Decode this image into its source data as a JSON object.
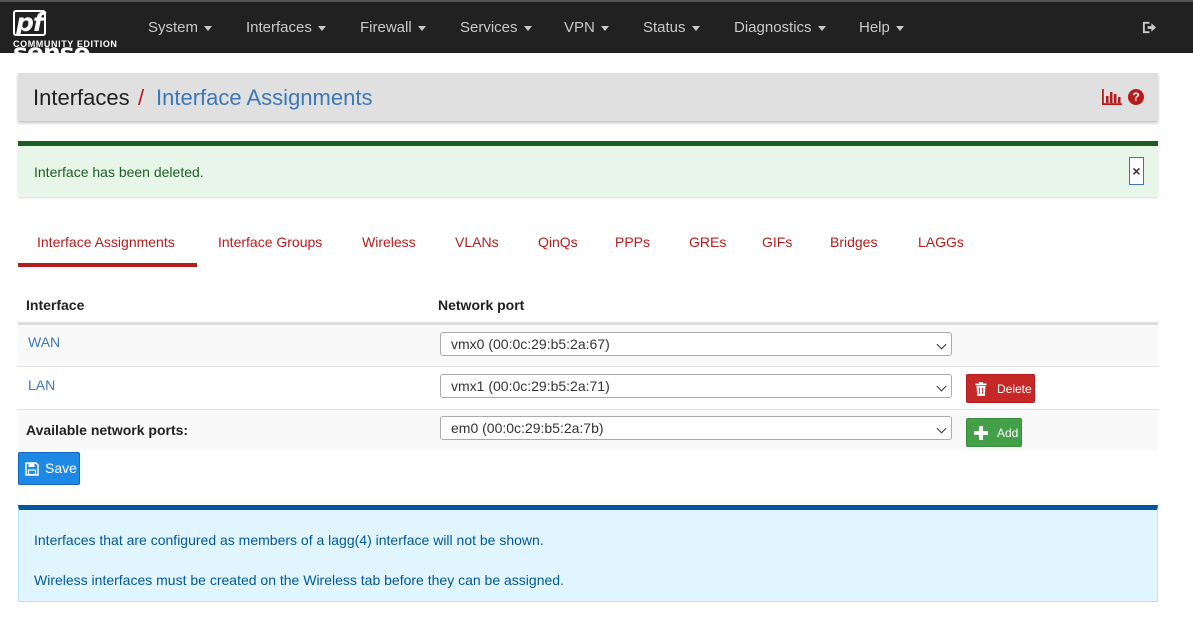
{
  "navbar": {
    "brand": "sense",
    "brand_prefix": "pf",
    "edition": "COMMUNITY EDITION",
    "items": [
      {
        "label": "System"
      },
      {
        "label": "Interfaces"
      },
      {
        "label": "Firewall"
      },
      {
        "label": "Services"
      },
      {
        "label": "VPN"
      },
      {
        "label": "Status"
      },
      {
        "label": "Diagnostics"
      },
      {
        "label": "Help"
      }
    ]
  },
  "breadcrumb": {
    "root": "Interfaces",
    "separator": "/",
    "current": "Interface Assignments",
    "help_glyph": "?"
  },
  "alert_success": {
    "message": "Interface has been deleted.",
    "close_glyph": "×"
  },
  "tabs": [
    {
      "label": "Interface Assignments",
      "active": true
    },
    {
      "label": "Interface Groups"
    },
    {
      "label": "Wireless"
    },
    {
      "label": "VLANs"
    },
    {
      "label": "QinQs"
    },
    {
      "label": "PPPs"
    },
    {
      "label": "GREs"
    },
    {
      "label": "GIFs"
    },
    {
      "label": "Bridges"
    },
    {
      "label": "LAGGs"
    }
  ],
  "table": {
    "headers": {
      "interface": "Interface",
      "network_port": "Network port"
    },
    "rows": [
      {
        "interface": "WAN",
        "port": "vmx0 (00:0c:29:b5:2a:67)"
      },
      {
        "interface": "LAN",
        "port": "vmx1 (00:0c:29:b5:2a:71)",
        "action": "Delete"
      }
    ],
    "available": {
      "label": "Available network ports:",
      "port": "em0 (00:0c:29:b5:2a:7b)",
      "action": "Add"
    }
  },
  "save_label": "Save",
  "alert_info": {
    "lines": [
      "Interfaces that are configured as members of a lagg(4) interface will not be shown.",
      "Wireless interfaces must be created on the Wireless tab before they can be assigned."
    ]
  },
  "colors": {
    "navbar_bg": "#212121",
    "accent_red": "#b71c1c",
    "link_blue": "#3c78b5",
    "success_green": "#1b5e20",
    "info_blue": "#01579b",
    "save_blue": "#1e88e5"
  },
  "icons": {
    "logout": "sign-out-icon",
    "chart": "bar-chart-icon",
    "help": "question-circle-icon",
    "delete": "trash-icon",
    "add": "plus-icon",
    "save": "floppy-disk-icon"
  }
}
